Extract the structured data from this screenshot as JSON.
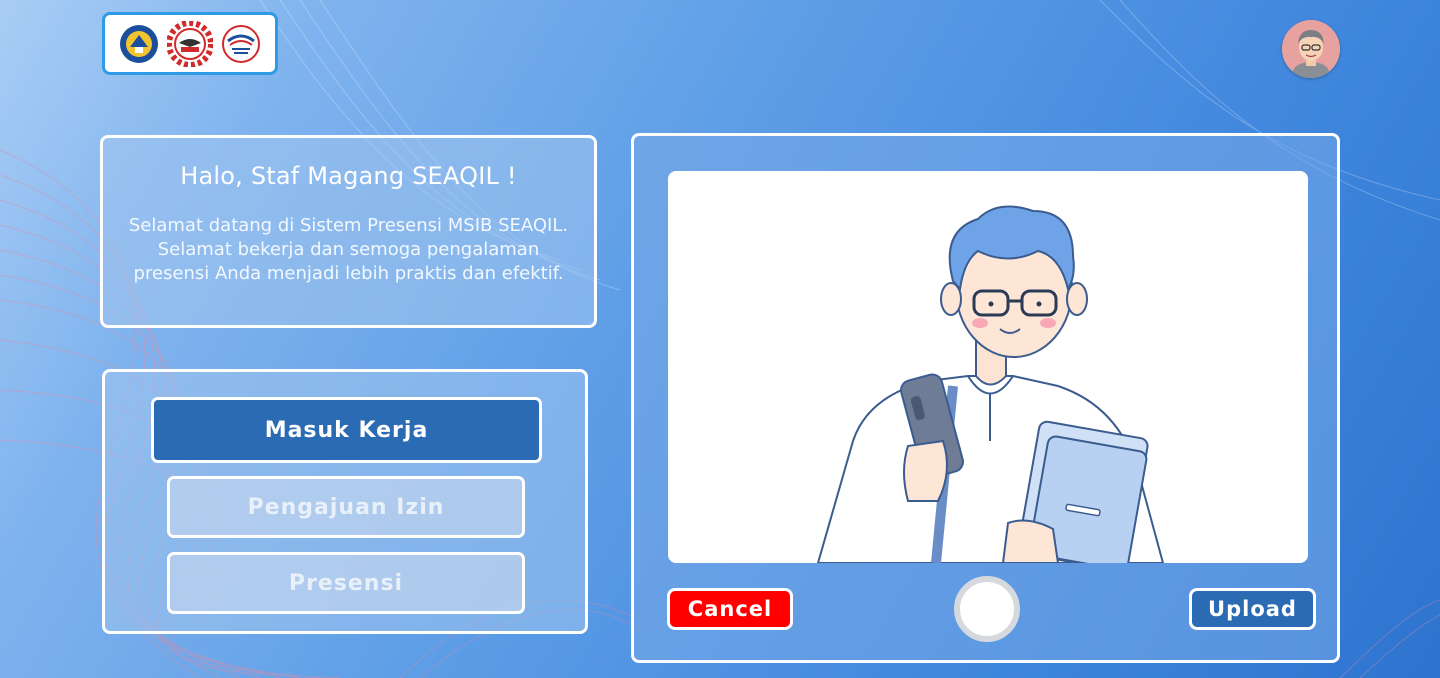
{
  "header": {
    "logos": [
      "kemendikbud-logo",
      "seameo-logo",
      "seaqil-logo"
    ],
    "avatar_icon": "user-avatar-icon"
  },
  "greeting": {
    "title": "Halo, Staf Magang SEAQIL !",
    "message": "Selamat datang di Sistem Presensi MSIB SEAQIL. Selamat bekerja dan semoga pengalaman presensi Anda menjadi lebih praktis dan efektif."
  },
  "menu": {
    "items": [
      {
        "label": "Masuk Kerja",
        "active": true
      },
      {
        "label": "Pengajuan Izin",
        "active": false
      },
      {
        "label": "Presensi",
        "active": false
      }
    ]
  },
  "camera": {
    "preview_icon": "student-illustration",
    "cancel_label": "Cancel",
    "upload_label": "Upload",
    "shutter_icon": "shutter-button-icon"
  },
  "colors": {
    "primary": "#2a6bb4",
    "danger": "#ff0000",
    "panel_border": "#ffffff"
  }
}
